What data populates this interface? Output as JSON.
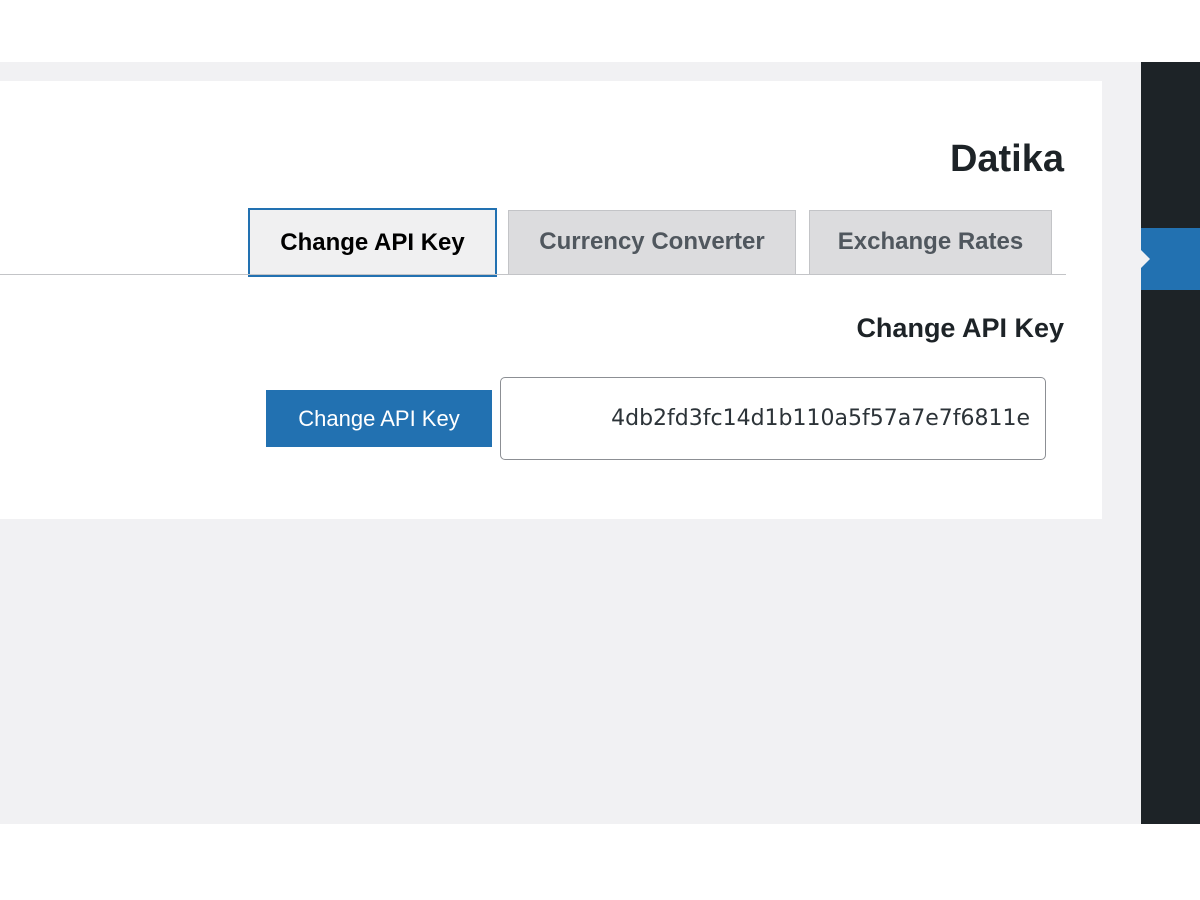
{
  "plugin": {
    "title": "Datika"
  },
  "tabs": [
    {
      "label": "Change API Key",
      "active": true
    },
    {
      "label": "Currency Converter",
      "active": false
    },
    {
      "label": "Exchange Rates",
      "active": false
    }
  ],
  "section": {
    "heading": "Change API Key"
  },
  "form": {
    "submit_label": "Change API Key",
    "api_key_value": "4db2fd3fc14d1b110a5f57a7e7f6811e"
  },
  "colors": {
    "accent": "#2271b1",
    "admin_menu": "#1d2327",
    "content_background": "#f1f1f3"
  }
}
